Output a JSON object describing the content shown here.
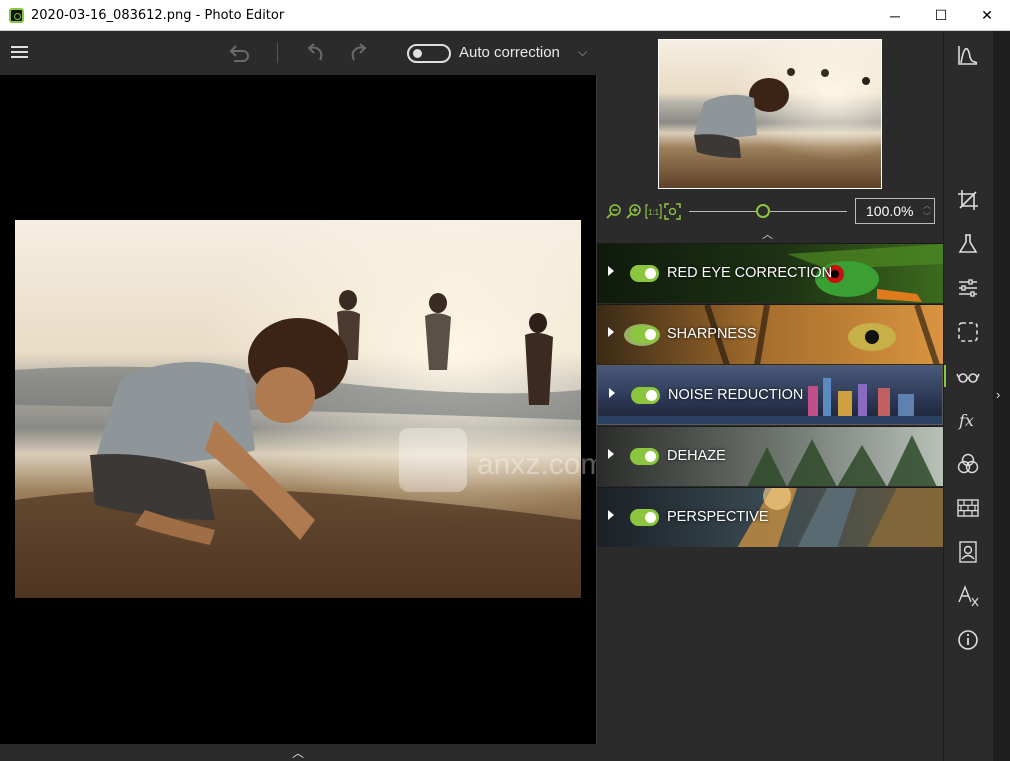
{
  "window": {
    "title": "2020-03-16_083612.png - Photo Editor",
    "controls": {
      "minimize": "─",
      "maximize": "☐",
      "close": "✕"
    }
  },
  "toolbar": {
    "auto_correction_label": "Auto correction",
    "auto_correction_enabled": false,
    "icons": [
      "menu-icon",
      "undo-all-icon",
      "undo-icon",
      "redo-icon",
      "chevron-down-icon"
    ]
  },
  "zoom": {
    "value": "100.0%",
    "level_fraction": 0.47,
    "icons": [
      "zoom-out-icon",
      "zoom-in-icon",
      "actual-size-icon",
      "fit-to-screen-icon"
    ]
  },
  "modules": [
    {
      "label": "RED EYE CORRECTION",
      "enabled": true
    },
    {
      "label": "SHARPNESS",
      "enabled": true
    },
    {
      "label": "NOISE REDUCTION",
      "enabled": true
    },
    {
      "label": "DEHAZE",
      "enabled": true
    },
    {
      "label": "PERSPECTIVE",
      "enabled": true
    }
  ],
  "rail": {
    "icons": [
      "histogram-icon",
      "crop-icon",
      "flask-icon",
      "adjustments-icon",
      "selection-icon",
      "glasses-icon",
      "fx-icon",
      "color-circles-icon",
      "bricks-icon",
      "portrait-icon",
      "text-effects-icon",
      "info-icon"
    ],
    "active": "glasses-icon"
  },
  "watermark": {
    "text": "anxz.com"
  },
  "colors": {
    "accent": "#8cc63f",
    "panel": "#2b2b2b",
    "canvas": "#000000"
  }
}
